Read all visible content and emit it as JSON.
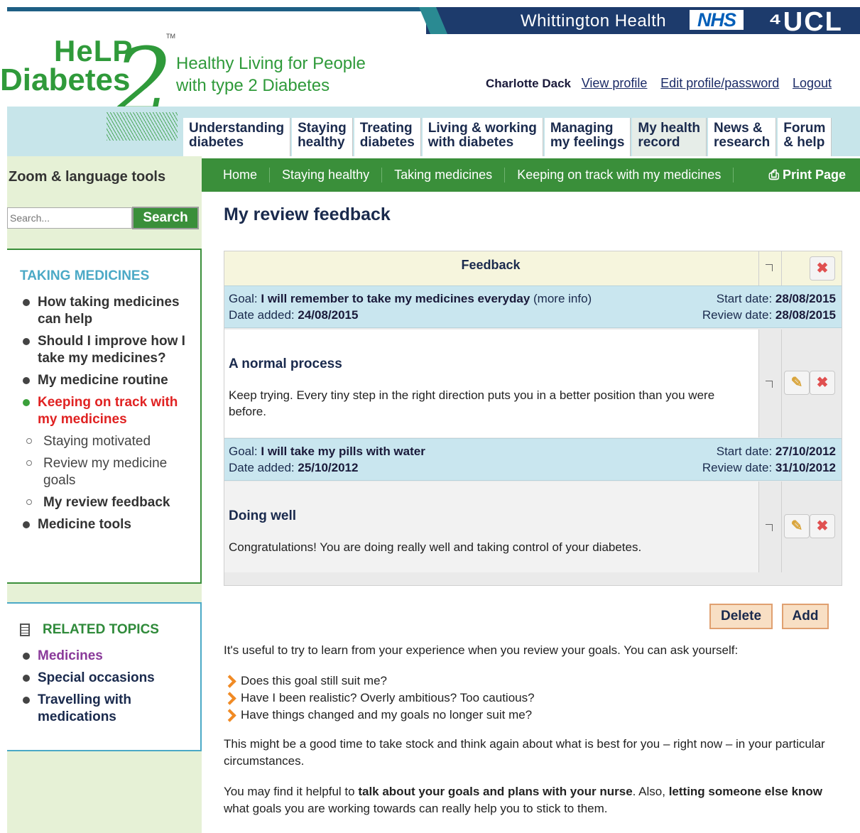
{
  "header": {
    "org_name": "Whittington Health",
    "nhs": "NHS",
    "ucl": "⁴UCL",
    "logo_help": "HeLP",
    "logo_diabetes": "Diabetes",
    "logo_two": "2",
    "logo_tm": "TM",
    "tagline_line1": "Healthy Living for People",
    "tagline_line2": "with type 2 Diabetes",
    "user_name": "Charlotte Dack",
    "view_profile": "View profile",
    "edit_profile": "Edit profile/password",
    "logout": "Logout"
  },
  "nav": {
    "tabs": [
      {
        "line1": "Understanding",
        "line2": "diabetes"
      },
      {
        "line1": "Staying",
        "line2": "healthy"
      },
      {
        "line1": "Treating",
        "line2": "diabetes"
      },
      {
        "line1": "Living & working",
        "line2": "with diabetes"
      },
      {
        "line1": "Managing",
        "line2": "my feelings"
      },
      {
        "line1": "My health",
        "line2": "record"
      },
      {
        "line1": "News &",
        "line2": "research"
      },
      {
        "line1": "Forum",
        "line2": "& help"
      }
    ]
  },
  "sidebar": {
    "zoom_tools": "Zoom & language tools",
    "search_placeholder": "Search...",
    "search_button": "Search",
    "section_title": "TAKING MEDICINES",
    "items": [
      "How taking medicines can help",
      "Should I improve how I take my medicines?",
      "My medicine routine",
      "Keeping on track with my medicines",
      "Staying motivated",
      "Review my medicine goals",
      "My review feedback",
      "Medicine tools"
    ],
    "related_title": "RELATED TOPICS",
    "related": [
      "Medicines",
      "Special occasions",
      "Travelling with medications"
    ]
  },
  "breadcrumb": {
    "items": [
      "Home",
      "Staying healthy",
      "Taking medicines",
      "Keeping on track with my medicines"
    ],
    "print": "Print Page"
  },
  "main": {
    "title": "My review feedback",
    "table_header": "Feedback",
    "goals": [
      {
        "goal_prefix": "Goal:",
        "goal": "I will remember to take my medicines everyday",
        "more_info": "(more info)",
        "date_added_label": "Date added:",
        "date_added": "24/08/2015",
        "start_label": "Start date:",
        "start": "28/08/2015",
        "review_label": "Review date:",
        "review": "28/08/2015",
        "feedback_title": "A normal process",
        "feedback_text": "Keep trying. Every tiny step in the right direction puts you in a better position than you were before."
      },
      {
        "goal_prefix": "Goal:",
        "goal": "I will take my pills with water",
        "more_info": "",
        "date_added_label": "Date added:",
        "date_added": "25/10/2012",
        "start_label": "Start date:",
        "start": "27/10/2012",
        "review_label": "Review date:",
        "review": "31/10/2012",
        "feedback_title": "Doing well",
        "feedback_text": "Congratulations! You are doing really well and taking control of your diabetes."
      }
    ],
    "delete_button": "Delete",
    "add_button": "Add",
    "intro": "It's useful to try to learn from your experience when you review your goals. You can ask yourself:",
    "questions": [
      "Does this goal still suit me?",
      "Have I been realistic? Overly ambitious? Too cautious?",
      "Have things changed and my goals no longer suit me?"
    ],
    "para2": "This might be a good time to take stock and think again about what is best for you – right now – in your particular circumstances.",
    "para3_a": "You may find it helpful to ",
    "para3_b": "talk about your goals and plans with your nurse",
    "para3_c": ". Also, ",
    "para3_d": "letting someone else know",
    "para3_e": " what goals you are working towards can really help you to stick to them."
  },
  "colors": {
    "brand_green": "#2f9a3a",
    "nav_green": "#3a8f3a",
    "accent_teal": "#4ba9c6",
    "nhs_blue": "#005eb8",
    "top_navy": "#1d3b6c",
    "current_red": "#e02222"
  }
}
